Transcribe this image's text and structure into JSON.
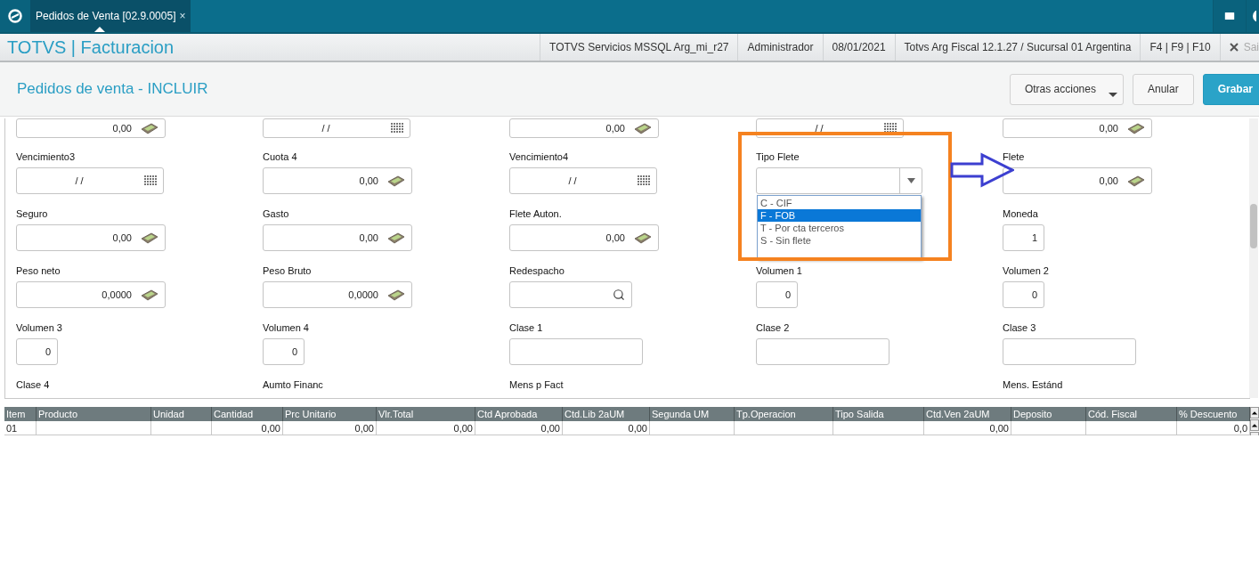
{
  "topbar": {
    "tab": {
      "label": "Pedidos de Venta [02.9.0005]",
      "close": "×",
      "selected": true
    }
  },
  "appbar": {
    "title": "TOTVS | Facturacion",
    "info": [
      "TOTVS Servicios MSSQL Arg_mi_r27",
      "Administrador",
      "08/01/2021",
      "Totvs Arg Fiscal 12.1.27 / Sucursal 01 Argentina",
      "F4 | F9 | F10"
    ],
    "exit": "Sai"
  },
  "header": {
    "title": "Pedidos de venta - INCLUIR",
    "buttons": [
      {
        "label": "Otras acciones",
        "kind": "menu"
      },
      {
        "label": "Anular",
        "kind": "default"
      },
      {
        "label": "Grabar",
        "kind": "primary"
      }
    ]
  },
  "form": {
    "rows": [
      [
        {
          "kind": "money",
          "value": "0,00"
        },
        {
          "kind": "date",
          "value": "/ /"
        },
        {
          "kind": "money",
          "value": "0,00"
        },
        {
          "kind": "date",
          "value": "/ /"
        },
        {
          "kind": "money",
          "value": "0,00"
        }
      ],
      [
        {
          "kind": "date",
          "label": "Vencimiento3",
          "value": "/ /"
        },
        {
          "kind": "money",
          "label": "Cuota 4",
          "value": "0,00"
        },
        {
          "kind": "date",
          "label": "Vencimiento4",
          "value": "/ /"
        },
        {
          "kind": "select",
          "label": "Tipo Flete",
          "expanded": true,
          "options": [
            {
              "label": "C - CIF",
              "selected": false
            },
            {
              "label": "F - FOB",
              "selected": true
            },
            {
              "label": "T - Por cta terceros",
              "selected": false
            },
            {
              "label": "S - Sin flete",
              "selected": false
            }
          ]
        },
        {
          "kind": "money",
          "label": "Flete",
          "value": "0,00"
        }
      ],
      [
        {
          "kind": "money",
          "label": "Seguro",
          "value": "0,00"
        },
        {
          "kind": "money",
          "label": "Gasto",
          "value": "0,00"
        },
        {
          "kind": "money",
          "label": "Flete Auton.",
          "value": "0,00"
        },
        null,
        {
          "kind": "number",
          "label": "Moneda",
          "value": "1"
        }
      ],
      [
        {
          "kind": "money",
          "label": "Peso neto",
          "value": "0,0000"
        },
        {
          "kind": "money",
          "label": "Peso Bruto",
          "value": "0,0000"
        },
        {
          "kind": "search",
          "label": "Redespacho"
        },
        {
          "kind": "number",
          "label": "Volumen 1",
          "value": "0"
        },
        {
          "kind": "number",
          "label": "Volumen 2",
          "value": "0"
        }
      ],
      [
        {
          "kind": "number",
          "label": "Volumen 3",
          "value": "0"
        },
        {
          "kind": "number",
          "label": "Volumen 4",
          "value": "0"
        },
        {
          "kind": "text",
          "label": "Clase 1"
        },
        {
          "kind": "text",
          "label": "Clase 2"
        },
        {
          "kind": "text",
          "label": "Clase 3"
        }
      ],
      [
        {
          "kind": "label",
          "label": "Clase 4"
        },
        {
          "kind": "label",
          "label": "Aumto Financ"
        },
        {
          "kind": "label",
          "label": "Mens p Fact"
        },
        null,
        {
          "kind": "label",
          "label": "Mens. Estánd"
        }
      ]
    ]
  },
  "grid": {
    "columns": [
      "Item",
      "Producto",
      "Unidad",
      "Cantidad",
      "Prc Unitario",
      "Vlr.Total",
      "Ctd Aprobada",
      "Ctd.Lib 2aUM",
      "Segunda UM",
      "Tp.Operacion",
      "Tipo Salida",
      "Ctd.Ven 2aUM",
      "Deposito",
      "Cód. Fiscal",
      "% Descuento"
    ],
    "rows": [
      [
        "01",
        null,
        null,
        "0,00",
        "0,00",
        "0,00",
        "0,00",
        "0,00",
        null,
        null,
        null,
        "0,00",
        null,
        null,
        "0,0"
      ]
    ]
  }
}
